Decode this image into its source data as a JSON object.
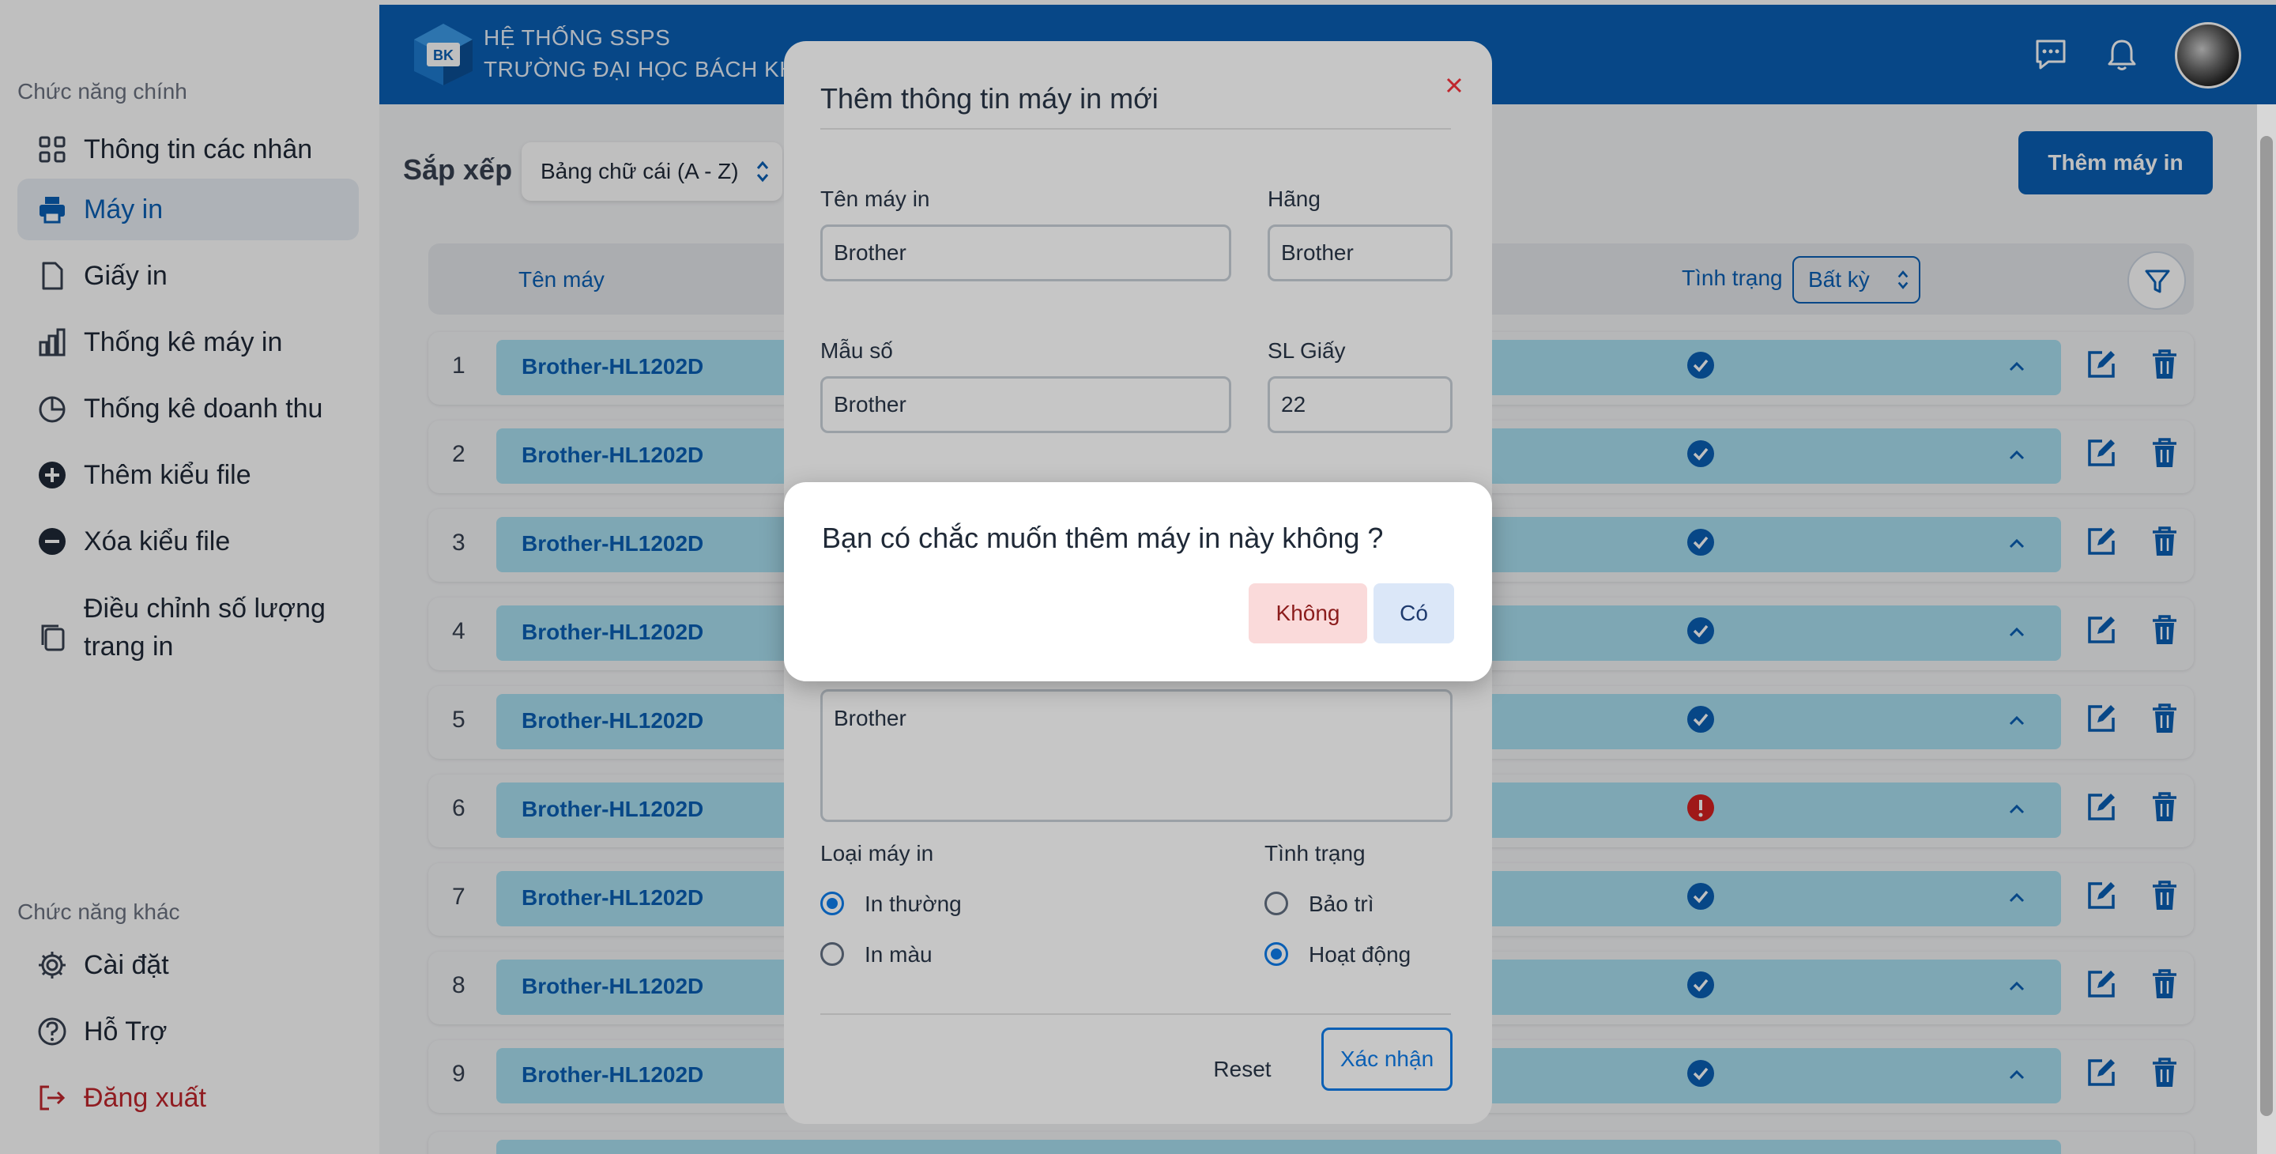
{
  "header": {
    "line1": "HỆ THỐNG SSPS",
    "line2": "TRƯỜNG ĐẠI HỌC BÁCH KHOA",
    "logo_text": "BK",
    "icons": [
      "chat-icon",
      "bell-icon"
    ]
  },
  "sidebar": {
    "main_section": "Chức năng chính",
    "main_items": [
      {
        "label": "Thông tin các nhân",
        "icon": "grid-icon"
      },
      {
        "label": "Máy in",
        "icon": "printer-icon"
      },
      {
        "label": "Giấy in",
        "icon": "paper-icon"
      },
      {
        "label": "Thống kê máy in",
        "icon": "bar-chart-icon"
      },
      {
        "label": "Thống kê doanh thu",
        "icon": "pie-chart-icon"
      },
      {
        "label": "Thêm kiểu file",
        "icon": "plus-circle-icon"
      },
      {
        "label": "Xóa kiểu file",
        "icon": "minus-circle-icon"
      },
      {
        "label": "Điều chỉnh số lượng trang in",
        "icon": "copy-icon"
      }
    ],
    "other_section": "Chức năng khác",
    "other_items": [
      {
        "label": "Cài đặt",
        "icon": "gear-icon"
      },
      {
        "label": "Hỗ Trợ",
        "icon": "help-icon"
      },
      {
        "label": "Đăng xuất",
        "icon": "logout-icon"
      }
    ]
  },
  "toolbar": {
    "sort_label": "Sắp xếp",
    "sort_value": "Bảng chữ cái (A - Z)",
    "add_button": "Thêm máy in"
  },
  "table": {
    "col_name": "Tên máy",
    "col_status": "Tình trạng",
    "status_filter": "Bất kỳ",
    "rows": [
      {
        "num": "1",
        "name": "Brother-HL1202D",
        "status": "ok"
      },
      {
        "num": "2",
        "name": "Brother-HL1202D",
        "status": "ok"
      },
      {
        "num": "3",
        "name": "Brother-HL1202D",
        "status": "ok"
      },
      {
        "num": "4",
        "name": "Brother-HL1202D",
        "status": "ok"
      },
      {
        "num": "5",
        "name": "Brother-HL1202D",
        "status": "ok"
      },
      {
        "num": "6",
        "name": "Brother-HL1202D",
        "status": "error"
      },
      {
        "num": "7",
        "name": "Brother-HL1202D",
        "status": "ok"
      },
      {
        "num": "8",
        "name": "Brother-HL1202D",
        "status": "ok"
      },
      {
        "num": "9",
        "name": "Brother-HL1202D",
        "status": "ok"
      }
    ]
  },
  "form": {
    "title": "Thêm thông tin máy in mới",
    "name_label": "Tên máy in",
    "name_value": "Brother",
    "brand_label": "Hãng",
    "brand_value": "Brother",
    "model_label": "Mẫu số",
    "model_value": "Brother",
    "paper_label": "SL Giấy",
    "paper_value": "22",
    "desc_value": "Brother",
    "type_label": "Loại máy in",
    "type_options": [
      "In thường",
      "In màu"
    ],
    "state_label": "Tình trạng",
    "state_options": [
      "Bảo trì",
      "Hoạt động"
    ],
    "reset": "Reset",
    "confirm": "Xác nhận"
  },
  "dialog": {
    "message": "Bạn có chắc muốn thêm máy in này không ?",
    "no": "Không",
    "yes": "Có"
  },
  "colors": {
    "primary": "#0a5fb4",
    "row_bar": "#a8dff1",
    "ok": "#0a5fb4",
    "error": "#d42020"
  }
}
